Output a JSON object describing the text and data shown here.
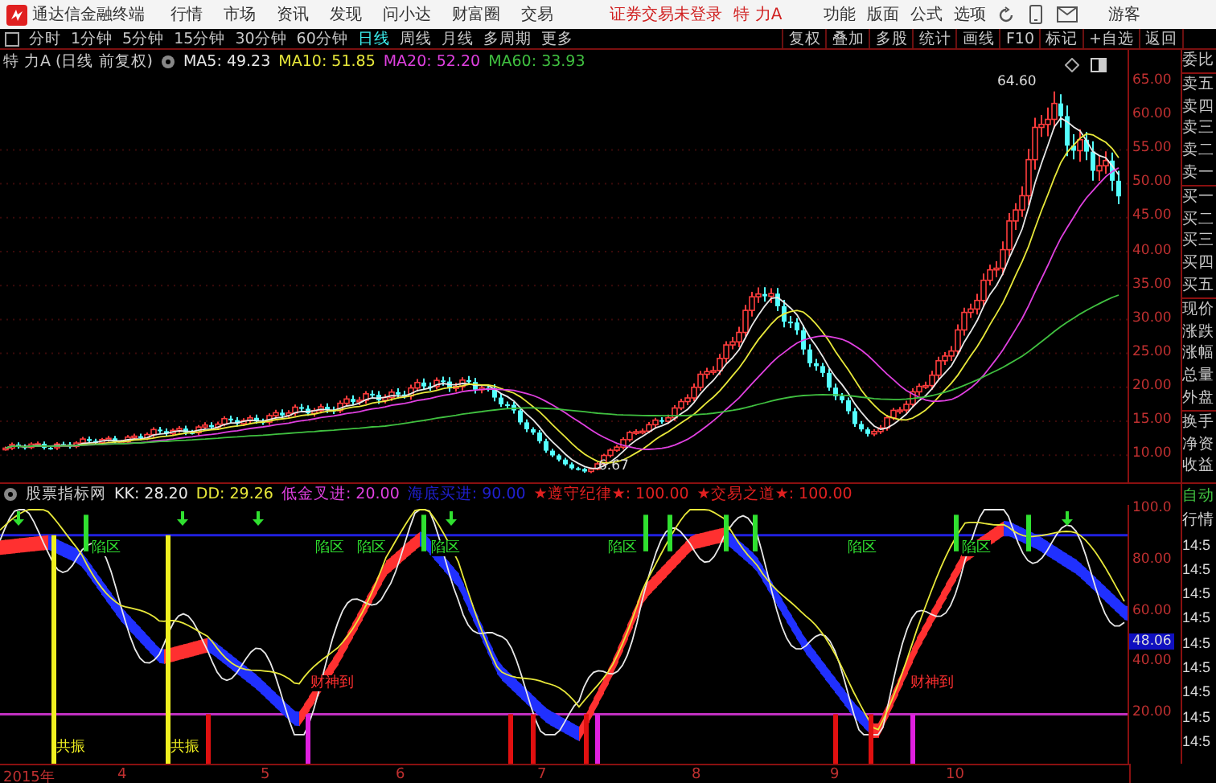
{
  "app": {
    "title": "通达信金融终端",
    "menus": [
      "行情",
      "市场",
      "资讯",
      "发现",
      "问小达",
      "财富圈",
      "交易"
    ],
    "login_status": "证券交易未登录",
    "stock_name": "特 力A",
    "tools": [
      "功能",
      "版面",
      "公式",
      "选项"
    ],
    "user": "游客"
  },
  "periods": [
    {
      "label": "分时",
      "selected": false
    },
    {
      "label": "1分钟",
      "selected": false
    },
    {
      "label": "5分钟",
      "selected": false
    },
    {
      "label": "15分钟",
      "selected": false
    },
    {
      "label": "30分钟",
      "selected": false
    },
    {
      "label": "60分钟",
      "selected": false
    },
    {
      "label": "日线",
      "selected": true
    },
    {
      "label": "周线",
      "selected": false
    },
    {
      "label": "月线",
      "selected": false
    },
    {
      "label": "多周期",
      "selected": false
    },
    {
      "label": "更多",
      "selected": false
    }
  ],
  "chart_buttons": [
    "复权",
    "叠加",
    "多股",
    "统计",
    "画线",
    "F10",
    "标记",
    "+自选",
    "返回"
  ],
  "price_chart": {
    "title": "特 力A (日线 前复权)",
    "moving_averages": [
      {
        "label": "MA5: 49.23",
        "color": "#e8e8e8"
      },
      {
        "label": "MA10: 51.85",
        "color": "#e8e83a"
      },
      {
        "label": "MA20: 52.20",
        "color": "#e040e0"
      },
      {
        "label": "MA60: 33.93",
        "color": "#40c040"
      }
    ],
    "high_label": "64.60",
    "low_label": "6.67",
    "y_axis": [
      "65.00",
      "60.00",
      "55.00",
      "50.00",
      "45.00",
      "40.00",
      "35.00",
      "30.00",
      "25.00",
      "20.00",
      "15.00",
      "10.00"
    ]
  },
  "quote_panel": [
    "委比",
    "卖五",
    "卖四",
    "卖三",
    "卖二",
    "卖一",
    "买一",
    "买二",
    "买三",
    "买四",
    "买五",
    "现价",
    "涨跌",
    "涨幅",
    "总量",
    "外盘",
    "换手",
    "净资",
    "收益"
  ],
  "indicator": {
    "name": "股票指标网",
    "values": [
      {
        "label": "KK: 28.20",
        "color": "#e8e8e8"
      },
      {
        "label": "DD: 29.26",
        "color": "#e8e83a"
      },
      {
        "label": "低金叉进: 20.00",
        "color": "#e040e0"
      },
      {
        "label": "海底买进: 90.00",
        "color": "#2020d0"
      },
      {
        "label": "★遵守纪律★: 100.00",
        "color": "#e02020"
      },
      {
        "label": "★交易之道★: 100.00",
        "color": "#e02020"
      }
    ],
    "signals": [
      {
        "kind": "zone",
        "text": "陷区"
      },
      {
        "kind": "zone",
        "text": "陷区"
      },
      {
        "kind": "zone",
        "text": "陷区"
      },
      {
        "kind": "zone",
        "text": "陷区"
      },
      {
        "kind": "zone",
        "text": "陷区"
      },
      {
        "kind": "zone",
        "text": "陷区"
      },
      {
        "kind": "zone",
        "text": "陷区"
      },
      {
        "kind": "wealth",
        "text": "财神到"
      },
      {
        "kind": "wealth",
        "text": "财神到"
      },
      {
        "kind": "resonance",
        "text": "共振"
      },
      {
        "kind": "resonance",
        "text": "共振"
      }
    ],
    "y_axis": [
      "100.0",
      "80.00",
      "60.00",
      "40.00",
      "20.00"
    ],
    "current_value": "48.06"
  },
  "side_panel": {
    "header": [
      "自动",
      "行情"
    ],
    "times": [
      "14:5",
      "14:5",
      "14:5",
      "14:5",
      "14:5",
      "14:5",
      "14:5",
      "14:5",
      "14:5"
    ]
  },
  "date_axis": [
    "2015年",
    "4",
    "5",
    "6",
    "7",
    "8",
    "9",
    "10"
  ]
}
